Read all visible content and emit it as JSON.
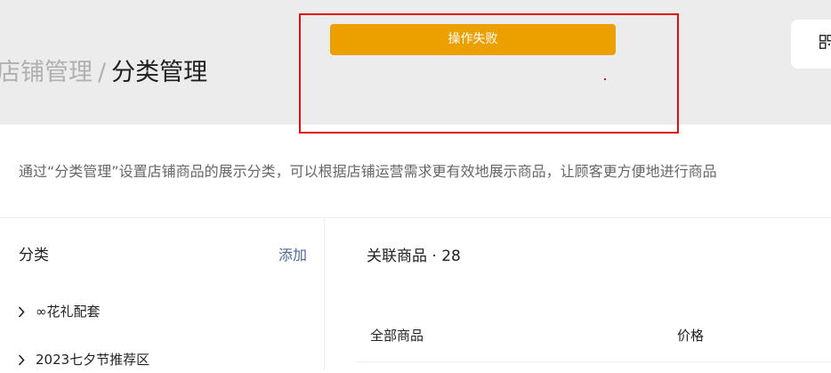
{
  "header": {
    "breadcrumb_parent": "店铺管理",
    "breadcrumb_separator": "/",
    "breadcrumb_current": "分类管理"
  },
  "toast": {
    "message": "操作失败"
  },
  "description": "通过“分类管理”设置店铺商品的展示分类，可以根据店铺运营需求更有效地展示商品，让顾客更方便地进行商品",
  "category_panel": {
    "title": "分类",
    "add_label": "添加",
    "items": [
      {
        "label": "∞花礼配套"
      },
      {
        "label": "2023七夕节推荐区"
      }
    ]
  },
  "product_panel": {
    "title": "关联商品",
    "separator": "·",
    "count": "28",
    "columns": [
      "全部商品",
      "价格"
    ]
  },
  "colors": {
    "toast_background": "#eba000",
    "highlight_border": "#e01010",
    "link": "#4a6a96"
  }
}
